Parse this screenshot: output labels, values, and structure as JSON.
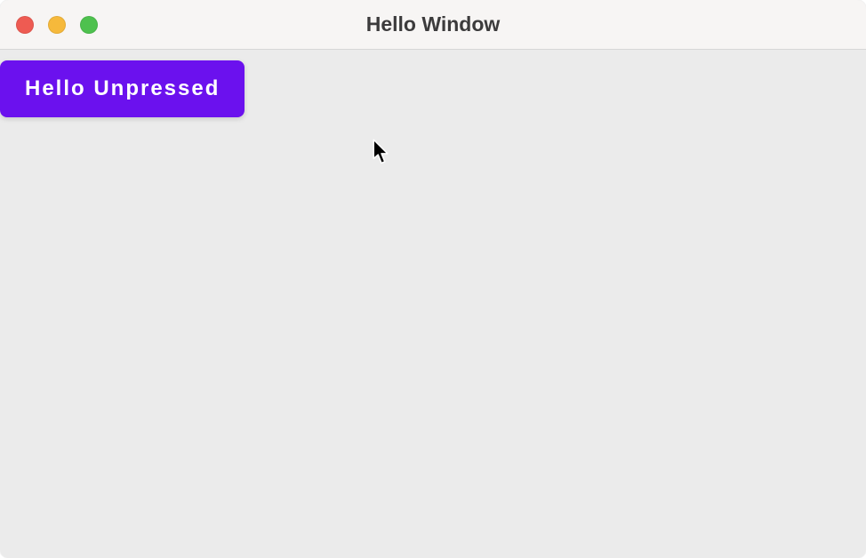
{
  "window": {
    "title": "Hello Window"
  },
  "content": {
    "button_label": "Hello Unpressed"
  },
  "colors": {
    "button_bg": "#6b11ee",
    "button_text": "#ffffff",
    "content_bg": "#ebebeb",
    "titlebar_bg": "#f7f5f4"
  }
}
